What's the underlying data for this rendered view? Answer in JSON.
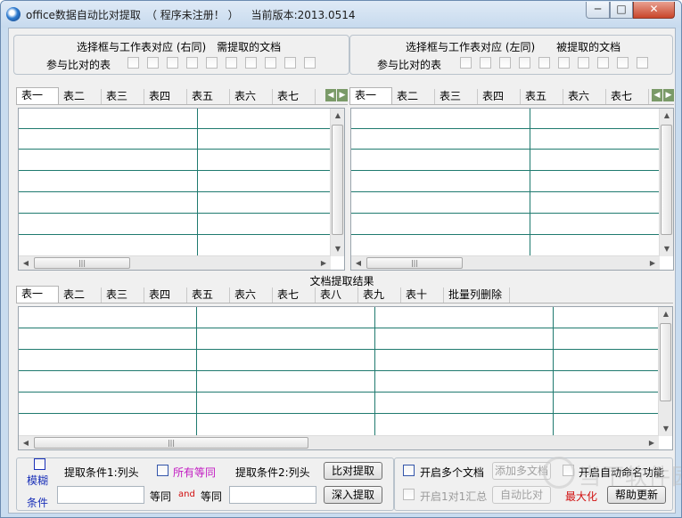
{
  "window": {
    "title": "office数据自动比对提取",
    "reg_status": "（ 程序未注册！ ）",
    "version": "当前版本:2013.0514"
  },
  "left_group": {
    "line1": "选择框与工作表对应 (右同)　需提取的文档",
    "line2": "参与比对的表"
  },
  "right_group": {
    "line1": "选择框与工作表对应 (左同)　　被提取的文档",
    "line2": "参与比对的表"
  },
  "sheet_tabs": [
    "表一",
    "表二",
    "表三",
    "表四",
    "表五",
    "表六",
    "表七"
  ],
  "results_title": "文档提取结果",
  "result_tabs": [
    "表一",
    "表二",
    "表三",
    "表四",
    "表五",
    "表六",
    "表七",
    "表八",
    "表九",
    "表十",
    "批量列删除"
  ],
  "bottom_left": {
    "fuzzy_line1": "模糊",
    "fuzzy_line2": "条件",
    "cond1_label": "提取条件1:列头",
    "all_equal_label": "所有等同",
    "cond2_label": "提取条件2:列头",
    "compare_button": "比对提取",
    "equal1": "等同",
    "and_text": "and",
    "equal2": "等同",
    "deep_button": "深入提取"
  },
  "bottom_right": {
    "multi_doc_label": "开启多个文档",
    "add_docs_button": "添加多文档",
    "auto_name_label": "开启自动命名功能",
    "one_to_one_label": "开启1对1汇总",
    "auto_button": "自动比对",
    "maximize_text": "最大化",
    "help_button": "帮助更新"
  },
  "watermark": "当下软件园",
  "colors": {
    "grid_line": "#1f7a6f",
    "fuzzy_blue": "#1a30b8",
    "all_equal_magenta": "#c21ac2",
    "maximize_red": "#d10f0f"
  }
}
